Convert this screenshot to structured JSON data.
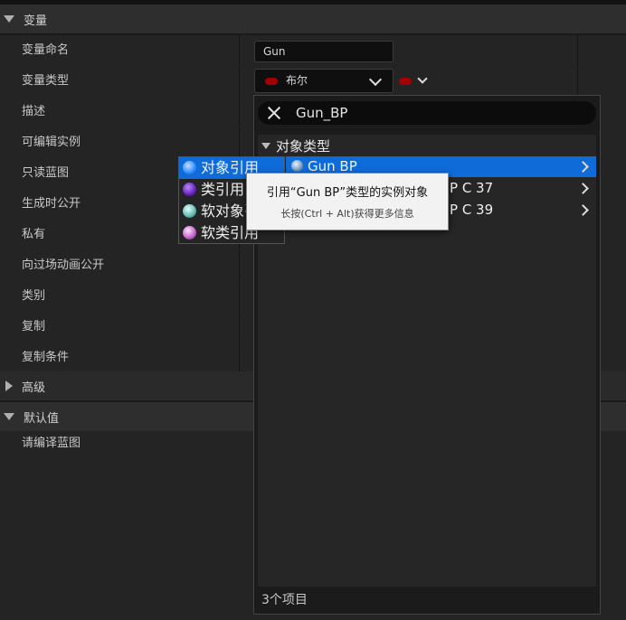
{
  "sections": {
    "variable_header": "变量",
    "advanced_header": "高级",
    "default_header": "默认值",
    "compile_hint": "请编译蓝图"
  },
  "rows": [
    {
      "label": "变量命名"
    },
    {
      "label": "变量类型"
    },
    {
      "label": "描述"
    },
    {
      "label": "可编辑实例"
    },
    {
      "label": "只读蓝图"
    },
    {
      "label": "生成时公开"
    },
    {
      "label": "私有"
    },
    {
      "label": "向过场动画公开"
    },
    {
      "label": "类别"
    },
    {
      "label": "复制"
    },
    {
      "label": "复制条件"
    }
  ],
  "variable_name_value": "Gun",
  "variable_type": {
    "label": "布尔",
    "pin_color": "#a30000"
  },
  "picker": {
    "search_value": "Gun_BP",
    "category": "对象类型",
    "items": [
      {
        "label": "Gun BP"
      },
      {
        "label": "P C 37"
      },
      {
        "label": "P C 39"
      }
    ],
    "footer": "3个项目"
  },
  "type_menu": [
    {
      "label": "对象引用",
      "icon": "object-reference-icon",
      "color": "#2f8cff"
    },
    {
      "label": "类引用",
      "icon": "class-reference-icon",
      "color": "#6a1fc0"
    },
    {
      "label": "软对象引用",
      "icon": "soft-object-reference-icon",
      "color": "#5fb9b0"
    },
    {
      "label": "软类引用",
      "icon": "soft-class-reference-icon",
      "color": "#c060c8"
    }
  ],
  "tooltip": {
    "title": "引用“Gun BP”类型的实例对象",
    "hint": "长按(Ctrl + Alt)获得更多信息"
  }
}
